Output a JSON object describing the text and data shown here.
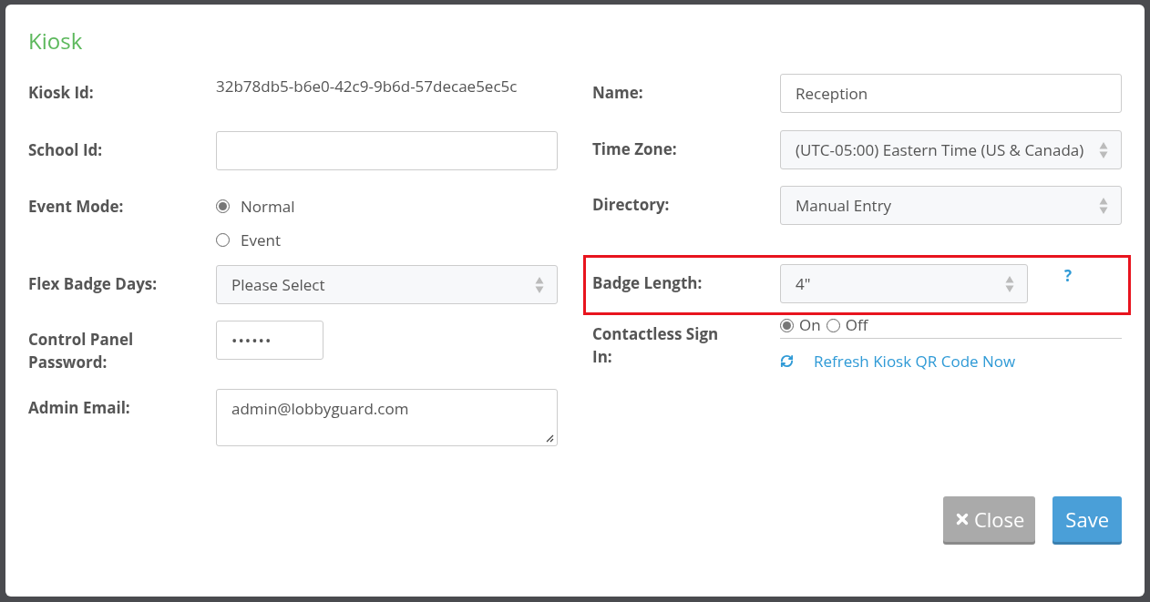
{
  "dialog": {
    "title": "Kiosk"
  },
  "left_fields": [
    {
      "kind": "text",
      "label": "Kiosk Id:",
      "value": "32b78db5-b6e0-42c9-9b6d-57decae5ec5c"
    },
    {
      "kind": "input",
      "label": "School Id:"
    },
    {
      "kind": "radio",
      "label": "Event Mode:",
      "options": [
        {
          "label": "Normal",
          "selected": true
        },
        {
          "label": "Event",
          "selected": false
        }
      ]
    },
    {
      "kind": "select",
      "label": "Flex Badge Days:",
      "value": "Please Select"
    },
    {
      "kind": "password",
      "label": "Control Panel Password:",
      "value": "••••••"
    },
    {
      "kind": "textarea",
      "label": "Admin Email:",
      "value": "admin@lobbyguard.com"
    }
  ],
  "right_fields": [
    {
      "kind": "input",
      "label": "Name:",
      "value": "Reception"
    },
    {
      "kind": "select",
      "label": "Time Zone:",
      "value": "(UTC-05:00) Eastern Time (US & Canada)"
    },
    {
      "kind": "select",
      "label": "Directory:",
      "value": "Manual Entry"
    },
    {
      "kind": "select",
      "label": "Badge Length:",
      "value": "4\"",
      "help": "?",
      "highlighted": true
    },
    {
      "kind": "inline-radio",
      "label": "Contactless Sign In:",
      "options": [
        {
          "label": "On",
          "selected": true
        },
        {
          "label": "Off",
          "selected": false
        }
      ],
      "link": "Refresh Kiosk QR Code Now"
    }
  ],
  "buttons": [
    {
      "kind": "close",
      "label": "Close"
    },
    {
      "kind": "save",
      "label": "Save"
    }
  ]
}
